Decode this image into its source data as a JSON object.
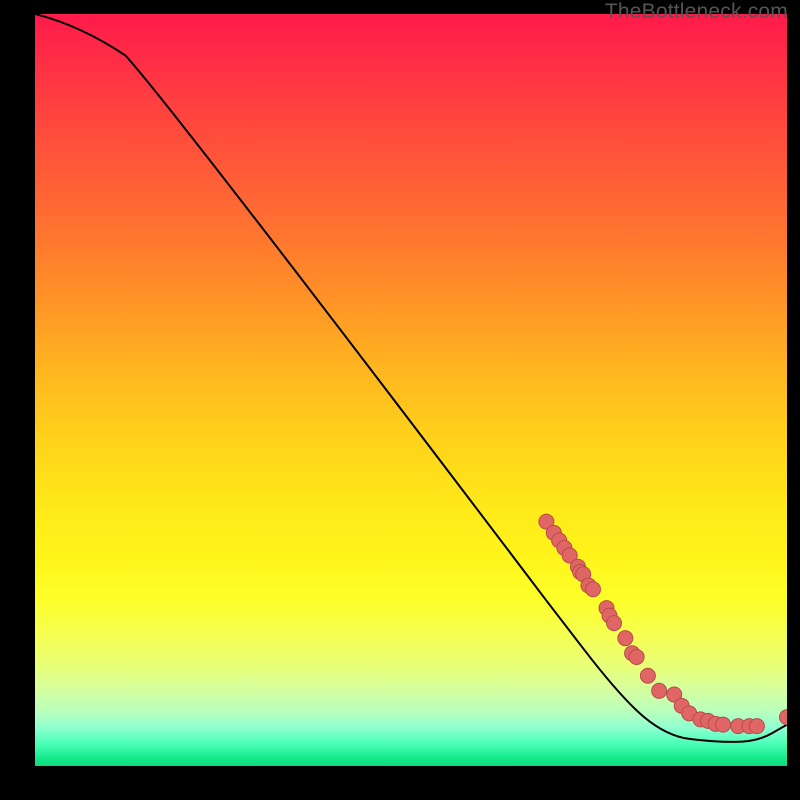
{
  "watermark": "TheBottleneck.com",
  "chart_data": {
    "type": "line",
    "title": "",
    "xlabel": "",
    "ylabel": "",
    "xlim": [
      0,
      100
    ],
    "ylim": [
      0,
      100
    ],
    "curve": [
      {
        "x": 0,
        "y": 100
      },
      {
        "x": 6,
        "y": 98.5
      },
      {
        "x": 12,
        "y": 94.5
      },
      {
        "x": 18,
        "y": 88
      },
      {
        "x": 68,
        "y": 22
      },
      {
        "x": 78,
        "y": 9
      },
      {
        "x": 84,
        "y": 4
      },
      {
        "x": 90,
        "y": 3.2
      },
      {
        "x": 96,
        "y": 3.2
      },
      {
        "x": 100,
        "y": 5.5
      }
    ],
    "points": [
      {
        "x": 68,
        "y": 32.5
      },
      {
        "x": 69.0,
        "y": 31.0
      },
      {
        "x": 69.7,
        "y": 30.0
      },
      {
        "x": 70.4,
        "y": 29.0
      },
      {
        "x": 71.1,
        "y": 28.0
      },
      {
        "x": 72.2,
        "y": 26.5
      },
      {
        "x": 72.5,
        "y": 25.8
      },
      {
        "x": 72.9,
        "y": 25.5
      },
      {
        "x": 73.6,
        "y": 24.0
      },
      {
        "x": 74.2,
        "y": 23.5
      },
      {
        "x": 76.0,
        "y": 21.0
      },
      {
        "x": 76.4,
        "y": 20.0
      },
      {
        "x": 77.0,
        "y": 19.0
      },
      {
        "x": 78.5,
        "y": 17.0
      },
      {
        "x": 79.4,
        "y": 15.0
      },
      {
        "x": 80.0,
        "y": 14.5
      },
      {
        "x": 81.5,
        "y": 12.0
      },
      {
        "x": 83.0,
        "y": 10.0
      },
      {
        "x": 85.0,
        "y": 9.5
      },
      {
        "x": 86.0,
        "y": 8.0
      },
      {
        "x": 87.0,
        "y": 7.0
      },
      {
        "x": 88.5,
        "y": 6.2
      },
      {
        "x": 89.5,
        "y": 6.0
      },
      {
        "x": 90.5,
        "y": 5.6
      },
      {
        "x": 91.5,
        "y": 5.5
      },
      {
        "x": 93.5,
        "y": 5.3
      },
      {
        "x": 95.0,
        "y": 5.3
      },
      {
        "x": 96.0,
        "y": 5.3
      },
      {
        "x": 100.0,
        "y": 6.5
      }
    ],
    "colors": {
      "curve": "#000000",
      "points_fill": "#e06666",
      "points_stroke": "#b84a4a"
    }
  }
}
